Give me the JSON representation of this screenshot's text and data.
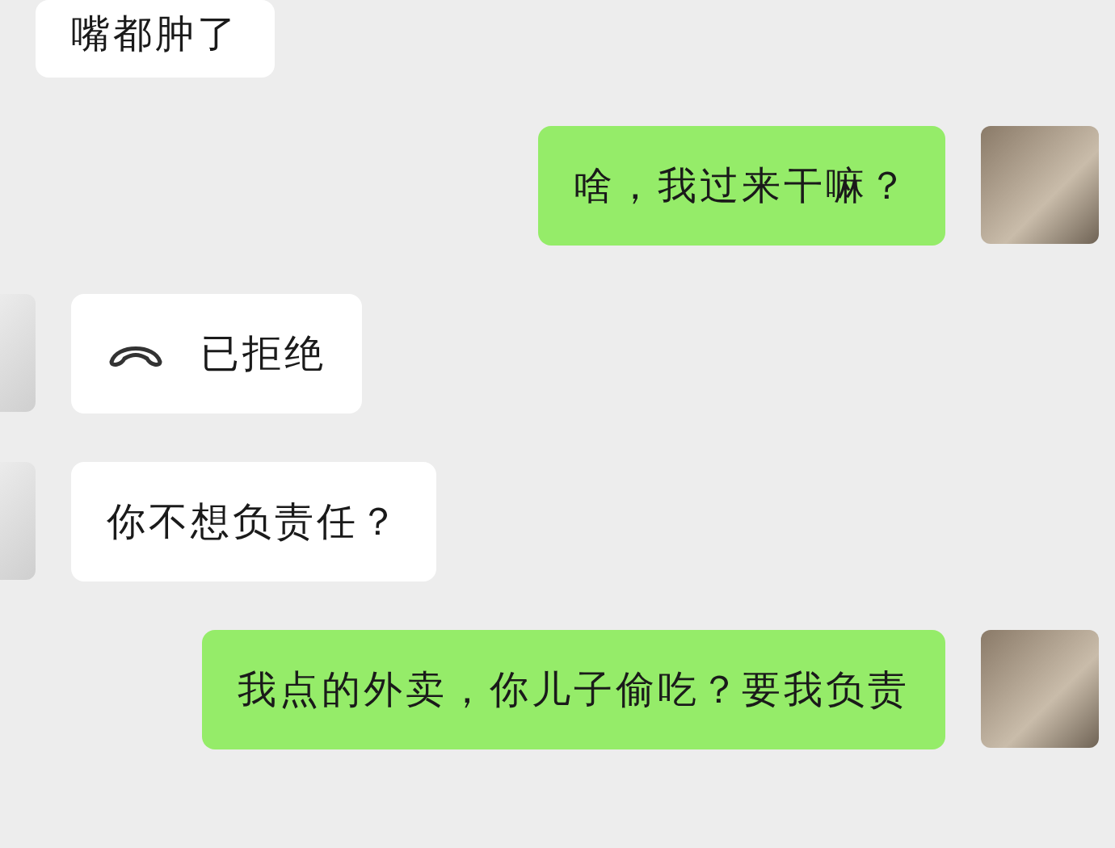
{
  "messages": [
    {
      "outgoing": false,
      "kind": "text",
      "text": "嘴都肿了"
    },
    {
      "outgoing": true,
      "kind": "text",
      "text": "啥，我过来干嘛？"
    },
    {
      "outgoing": false,
      "kind": "call",
      "text": "已拒绝"
    },
    {
      "outgoing": false,
      "kind": "text",
      "text": "你不想负责任？"
    },
    {
      "outgoing": true,
      "kind": "text",
      "text": "我点的外卖，你儿子偷吃？要我负责"
    }
  ]
}
